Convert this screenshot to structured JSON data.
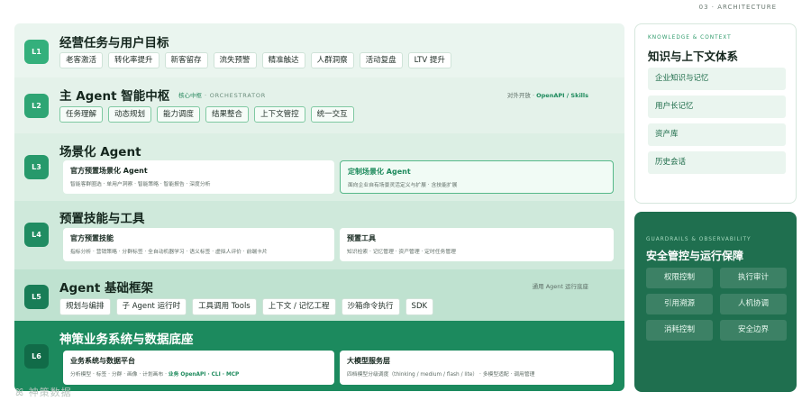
{
  "top_label": "03 · ARCHITECTURE",
  "layers": [
    {
      "id": "L1",
      "title": "经营任务与用户目标",
      "chips": [
        "老客激活",
        "转化率提升",
        "新客留存",
        "流失预警",
        "精准触达",
        "人群洞察",
        "活动复盘",
        "LTV 提升"
      ]
    },
    {
      "id": "L2",
      "title": "主 Agent 智能中枢",
      "tag_cn": "核心中枢",
      "tag_en": "· ORCHESTRATOR",
      "note_prefix": "对外开放 · ",
      "note_highlight": "OpenAPI / Skills",
      "chips": [
        "任务理解",
        "动态规划",
        "能力调度",
        "结果整合",
        "上下文管控",
        "统一交互"
      ]
    },
    {
      "id": "L3",
      "title": "场景化 Agent",
      "cards": [
        {
          "title": "官方预置场景化 Agent",
          "desc": "智能客群圈选 · 单用户洞察 · 智能策略 · 智能报告 · 深度分析"
        },
        {
          "title": "定制场景化 Agent",
          "desc": "面向企业自有场景灵活定义与扩展 · 含技能扩展"
        }
      ]
    },
    {
      "id": "L4",
      "title": "预置技能与工具",
      "cards": [
        {
          "title": "官方预置技能",
          "desc": "指标分析 · 营销策略 · 分群标签 · 全自动机器学习 · 语义标签 · 虚拟人评价 · 前端卡片"
        },
        {
          "title": "预置工具",
          "desc": "知识检索 · 记忆管理 · 资产管理 · 定时任务管理"
        }
      ]
    },
    {
      "id": "L5",
      "title": "Agent 基础框架",
      "note": "通用 Agent 运行底座",
      "chips": [
        "规划与编排",
        "子 Agent 运行时",
        "工具调用 Tools",
        "上下文 / 记忆工程",
        "沙箱命令执行",
        "SDK"
      ]
    },
    {
      "id": "L6",
      "title": "神策业务系统与数据底座",
      "cards": [
        {
          "title": "业务系统与数据平台",
          "desc": "分析模型 · 标签 · 分群 · 画像 · 计划画布 · ",
          "desc_highlight": "业务 OpenAPI · CLI · MCP"
        },
        {
          "title": "大模型服务层",
          "desc": "四档模型分级调度（thinking / medium / flash / lite） · 多模型适配 · 调用管理"
        }
      ]
    }
  ],
  "knowledge_panel": {
    "en": "KNOWLEDGE & CONTEXT",
    "title": "知识与上下文体系",
    "items": [
      "企业知识与记忆",
      "用户长记忆",
      "资产库",
      "历史会话"
    ]
  },
  "guardrails_panel": {
    "en": "GUARDRAILS & OBSERVABILITY",
    "title": "安全管控与运行保障",
    "items": [
      "权限控制",
      "执行审计",
      "引用溯源",
      "人机协调",
      "消耗控制",
      "安全边界"
    ]
  },
  "watermark": "ꕤ 神策数据"
}
